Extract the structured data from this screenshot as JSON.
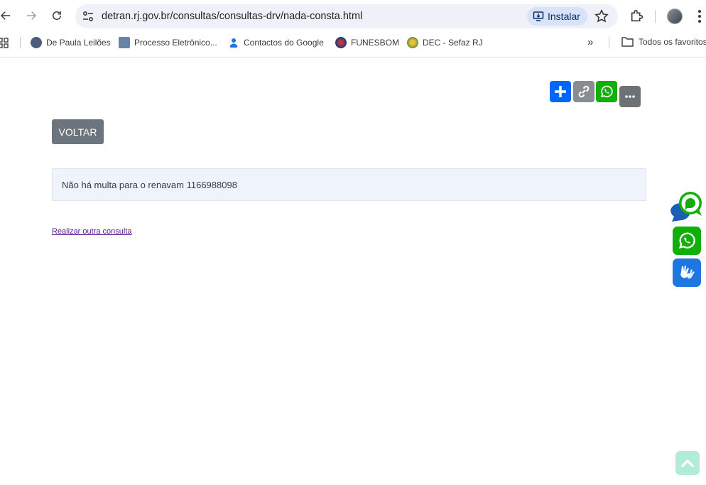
{
  "browser": {
    "url": "detran.rj.gov.br/consultas/consultas-drv/nada-consta.html",
    "install_label": "Instalar"
  },
  "bookmarks": {
    "items": [
      {
        "label": "De Paula Leilões",
        "icon": "gavel-icon",
        "color": "#4c5c7a"
      },
      {
        "label": "Processo Eletrônico...",
        "icon": "document-icon",
        "color": "#6b82a8"
      },
      {
        "label": "Contactos do Google",
        "icon": "person-icon",
        "color": "#1a73e8"
      },
      {
        "label": "FUNESBOM",
        "icon": "emblem-icon",
        "color": "#2b3d7a"
      },
      {
        "label": "DEC - Sefaz RJ",
        "icon": "seal-icon",
        "color": "#6a8a3a"
      }
    ],
    "all_bookmarks_label": "Todos os favoritos"
  },
  "page": {
    "back_button_label": "VOLTAR",
    "alert_message": "Não há multa para o renavam 1166988098",
    "another_query_link": "Realizar outra consulta"
  },
  "colors": {
    "share_blue": "#0166ff",
    "whatsapp_green": "#12af0a",
    "voltar_gray": "#6c757d",
    "alert_bg": "#eff4fc",
    "libras_blue": "#1f76e0",
    "back_to_top": "#b2ecd7"
  }
}
